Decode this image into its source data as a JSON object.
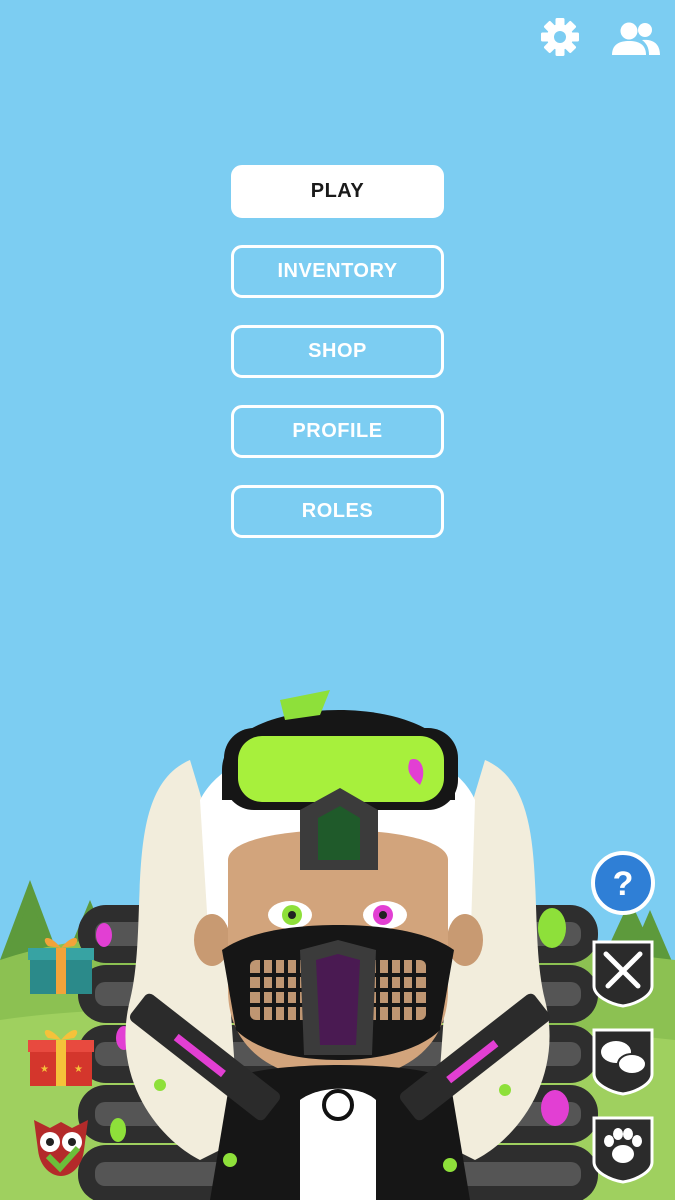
{
  "menu": {
    "play": "PLAY",
    "inventory": "INVENTORY",
    "shop": "SHOP",
    "profile": "PROFILE",
    "roles": "ROLES"
  },
  "help": {
    "symbol": "?"
  },
  "icons": {
    "top_right": [
      "gear-icon",
      "friends-icon"
    ],
    "left": [
      "gift-box-teal-icon",
      "gift-box-red-icon",
      "owl-emblem-icon"
    ],
    "right": [
      "help-icon",
      "crossed-swords-icon",
      "chat-bubbles-icon",
      "paw-icon"
    ]
  },
  "colors": {
    "sky": "#7ccdf2",
    "button_text": "#ffffff",
    "primary_button_bg": "#ffffff",
    "help_blue": "#2f7fd6",
    "shield_dark": "#2b2b2b",
    "paint_green": "#8ee03a",
    "paint_pink": "#e23fd3"
  }
}
